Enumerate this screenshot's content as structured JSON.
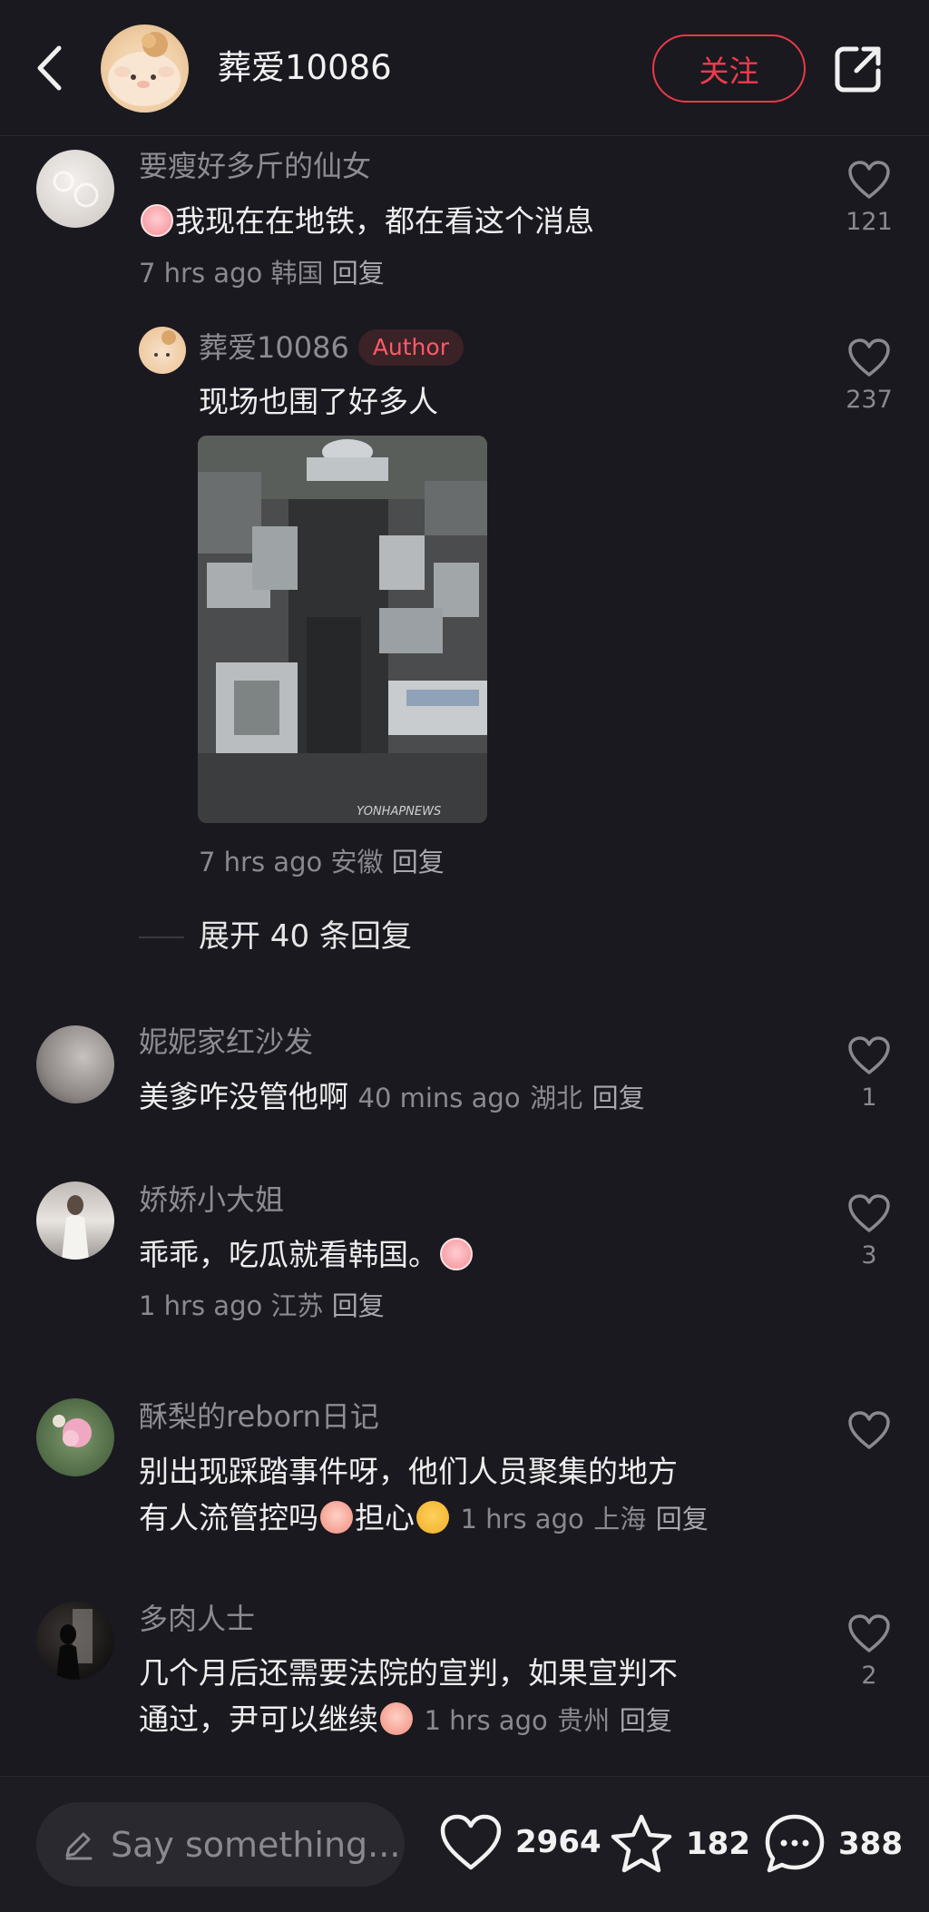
{
  "header": {
    "name": "葬爱10086",
    "follow_label": "关注"
  },
  "comments": [
    {
      "username": "要瘦好多斤的仙女",
      "text": "我现在在地铁，都在看这个消息",
      "time": "7 hrs ago",
      "location": "韩国",
      "reply": "回复",
      "likes": "121",
      "reply_item": {
        "username": "葬爱10086",
        "badge": "Author",
        "text": "现场也围了好多人",
        "photo_watermark": "YONHAPNEWS",
        "time": "7 hrs ago",
        "location": "安徽",
        "reply": "回复",
        "likes": "237"
      },
      "expand_label": "展开 40 条回复"
    },
    {
      "username": "妮妮家红沙发",
      "text": "美爹咋没管他啊",
      "time": "40 mins ago",
      "location": "湖北",
      "reply": "回复",
      "likes": "1"
    },
    {
      "username": "娇娇小大姐",
      "text": "乖乖，吃瓜就看韩国。",
      "time": "1 hrs ago",
      "location": "江苏",
      "reply": "回复",
      "likes": "3"
    },
    {
      "username": "酥梨的reborn日记",
      "text_line1": "别出现踩踏事件呀，他们人员聚集的地方",
      "text_line2a": "有人流管控吗",
      "text_line2b": "担心",
      "time": "1 hrs ago",
      "location": "上海",
      "reply": "回复",
      "likes": ""
    },
    {
      "username": "多肉人士",
      "text_line1": "几个月后还需要法院的宣判，如果宣判不",
      "text_line2": "通过，尹可以继续",
      "time": "1 hrs ago",
      "location": "贵州",
      "reply": "回复",
      "likes": "2"
    }
  ],
  "bottom_bar": {
    "placeholder": "Say something...",
    "likes": "2964",
    "favorites": "182",
    "comments": "388"
  },
  "colors": {
    "background": "#1a191f",
    "accent": "#ef3b4d"
  }
}
